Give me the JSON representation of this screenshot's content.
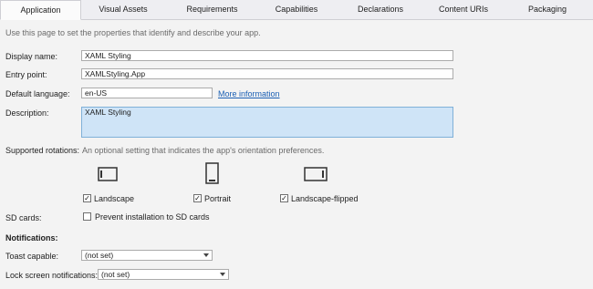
{
  "tabs": [
    "Application",
    "Visual Assets",
    "Requirements",
    "Capabilities",
    "Declarations",
    "Content URIs",
    "Packaging"
  ],
  "intro": "Use this page to set the properties that identify and describe your app.",
  "display_name": {
    "label": "Display name:",
    "value": "XAML Styling"
  },
  "entry_point": {
    "label": "Entry point:",
    "value": "XAMLStyling.App"
  },
  "default_language": {
    "label": "Default language:",
    "value": "en-US",
    "link": "More information"
  },
  "description": {
    "label": "Description:",
    "value": "XAML Styling"
  },
  "rotations": {
    "label": "Supported rotations:",
    "hint": "An optional setting that indicates the app's orientation preferences.",
    "options": [
      {
        "label": "Landscape",
        "checked": true,
        "icon": "landscape-icon"
      },
      {
        "label": "Portrait",
        "checked": true,
        "icon": "portrait-icon"
      },
      {
        "label": "Landscape-flipped",
        "checked": true,
        "icon": "landscape-flipped-icon"
      }
    ]
  },
  "sd_cards": {
    "label": "SD cards:",
    "option": "Prevent installation to SD cards",
    "checked": false
  },
  "notifications": {
    "heading": "Notifications:",
    "toast": {
      "label": "Toast capable:",
      "value": "(not set)"
    },
    "lock": {
      "label": "Lock screen notifications:",
      "value": "(not set)"
    }
  }
}
